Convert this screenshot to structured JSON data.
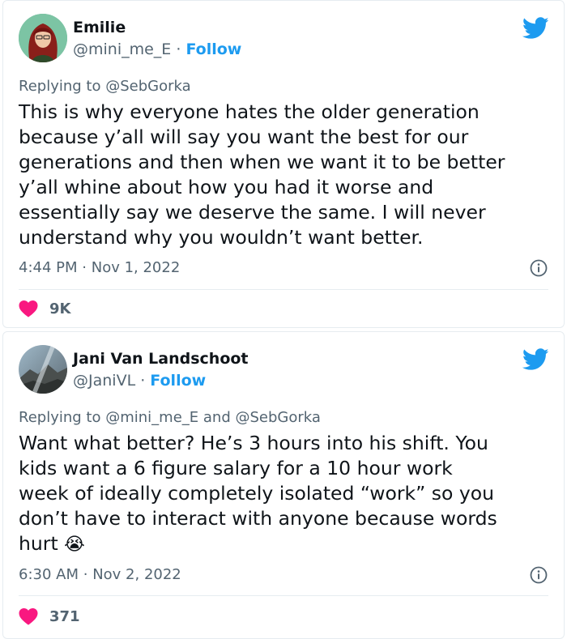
{
  "tweets": [
    {
      "author_name": "Emilie",
      "handle": "@mini_me_E",
      "separator": "·",
      "follow_label": "Follow",
      "replying_prefix": "Replying to",
      "replying_to": "@SebGorka",
      "replying_and": "",
      "replying_to_2": "",
      "text": "This is why everyone hates the older generation\nbecause y’all will say you want the best for our\ngenerations and then when we want it to be better\ny’all whine about how you had it worse and\nessentially say we deserve the same. I will never\nunderstand why you wouldn’t want better.",
      "time": "4:44 PM",
      "date": "Nov 1, 2022",
      "likes": "9K",
      "icons": {
        "bird": "twitter-bird-icon",
        "info": "info-icon",
        "heart": "heart-icon"
      }
    },
    {
      "author_name": "Jani Van Landschoot",
      "handle": "@JaniVL",
      "separator": "·",
      "follow_label": "Follow",
      "replying_prefix": "Replying to",
      "replying_to": "@mini_me_E",
      "replying_and": "and",
      "replying_to_2": "@SebGorka",
      "text": "Want what better? He’s 3 hours into his shift. You\nkids want a 6 figure salary for a 10 hour work\nweek of ideally completely isolated “work” so you\ndon’t have to interact with anyone because words\nhurt",
      "emoji": "😭",
      "time": "6:30 AM",
      "date": "Nov 2, 2022",
      "likes": "371",
      "icons": {
        "bird": "twitter-bird-icon",
        "info": "info-icon",
        "heart": "heart-icon"
      }
    }
  ],
  "colors": {
    "accent": "#1d9bf0",
    "secondary_text": "#536471",
    "heart": "#f91880",
    "divider": "#e6ecf0"
  }
}
